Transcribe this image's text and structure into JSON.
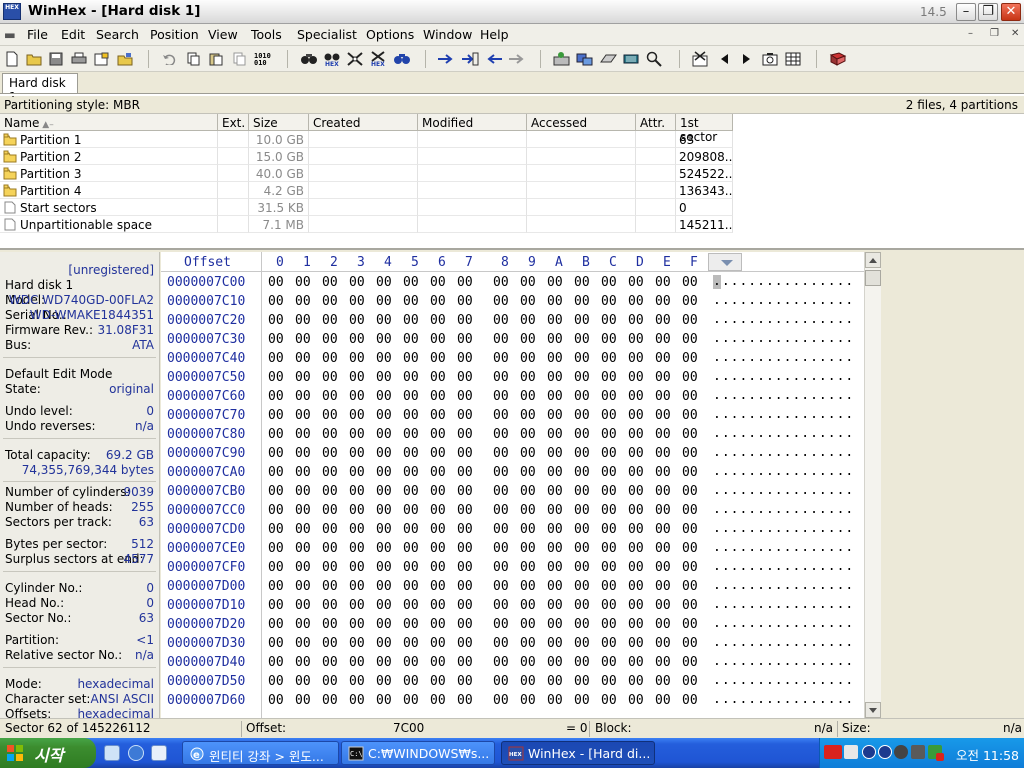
{
  "window": {
    "icon_text": "HEX",
    "title": "WinHex - [Hard disk 1]",
    "version": "14.5"
  },
  "menu": [
    "File",
    "Edit",
    "Search",
    "Position",
    "View",
    "Tools",
    "Specialist",
    "Options",
    "Window",
    "Help"
  ],
  "tabs": [
    {
      "label": "Hard disk 1"
    }
  ],
  "info": {
    "partitioning_style": "Partitioning style: MBR",
    "summary": "2 files, 4 partitions"
  },
  "partition_list": {
    "columns": [
      "Name",
      "Ext.",
      "Size",
      "Created",
      "Modified",
      "Accessed",
      "Attr.",
      "1st sector"
    ],
    "rows": [
      {
        "name": "Partition 1",
        "ext": "",
        "size": "10.0 GB",
        "created": "",
        "modified": "",
        "accessed": "",
        "attr": "",
        "first_sector": "63",
        "type": "folder"
      },
      {
        "name": "Partition 2",
        "ext": "",
        "size": "15.0 GB",
        "created": "",
        "modified": "",
        "accessed": "",
        "attr": "",
        "first_sector": "209808...",
        "type": "folder"
      },
      {
        "name": "Partition 3",
        "ext": "",
        "size": "40.0 GB",
        "created": "",
        "modified": "",
        "accessed": "",
        "attr": "",
        "first_sector": "524522...",
        "type": "folder"
      },
      {
        "name": "Partition 4",
        "ext": "",
        "size": "4.2 GB",
        "created": "",
        "modified": "",
        "accessed": "",
        "attr": "",
        "first_sector": "136343...",
        "type": "folder"
      },
      {
        "name": "Start sectors",
        "ext": "",
        "size": "31.5 KB",
        "created": "",
        "modified": "",
        "accessed": "",
        "attr": "",
        "first_sector": "0",
        "type": "file"
      },
      {
        "name": "Unpartitionable space",
        "ext": "",
        "size": "7.1 MB",
        "created": "",
        "modified": "",
        "accessed": "",
        "attr": "",
        "first_sector": "145211...",
        "type": "file"
      }
    ]
  },
  "details": {
    "unregistered": "[unregistered]",
    "disk_name": "Hard disk 1",
    "model_label": "Model:",
    "model_value": "WDC WD740GD-00FLA2",
    "serial_label": "Serial No.:",
    "serial_value": "WD-WMAKE1844351",
    "firmware_label": "Firmware Rev.:",
    "firmware_value": "31.08F31",
    "bus_label": "Bus:",
    "bus_value": "ATA",
    "edit_mode_label": "Default Edit Mode",
    "state_label": "State:",
    "state_value": "original",
    "undo_level_label": "Undo level:",
    "undo_level_value": "0",
    "undo_reverses_label": "Undo reverses:",
    "undo_reverses_value": "n/a",
    "total_capacity_label": "Total capacity:",
    "total_capacity_gb": "69.2 GB",
    "total_capacity_bytes": "74,355,769,344 bytes",
    "cylinders_label": "Number of cylinders:",
    "cylinders_value": "9039",
    "heads_label": "Number of heads:",
    "heads_value": "255",
    "sectors_track_label": "Sectors per track:",
    "sectors_track_value": "63",
    "bytes_sector_label": "Bytes per sector:",
    "bytes_sector_value": "512",
    "surplus_label": "Surplus sectors at end:",
    "surplus_value": "4577",
    "cylinder_no_label": "Cylinder No.:",
    "cylinder_no_value": "0",
    "head_no_label": "Head No.:",
    "head_no_value": "0",
    "sector_no_label": "Sector No.:",
    "sector_no_value": "63",
    "partition_label": "Partition:",
    "partition_value": "<1",
    "relative_sector_label": "Relative sector No.:",
    "relative_sector_value": "n/a",
    "mode_label": "Mode:",
    "mode_value": "hexadecimal",
    "charset_label": "Character set:",
    "charset_value": "ANSI ASCII",
    "offsets_label": "Offsets:",
    "offsets_value": "hexadecimal"
  },
  "hex": {
    "offset_header": "Offset",
    "columns": [
      "0",
      "1",
      "2",
      "3",
      "4",
      "5",
      "6",
      "7",
      "8",
      "9",
      "A",
      "B",
      "C",
      "D",
      "E",
      "F"
    ],
    "rows": [
      "0000007C00",
      "0000007C10",
      "0000007C20",
      "0000007C30",
      "0000007C40",
      "0000007C50",
      "0000007C60",
      "0000007C70",
      "0000007C80",
      "0000007C90",
      "0000007CA0",
      "0000007CB0",
      "0000007CC0",
      "0000007CD0",
      "0000007CE0",
      "0000007CF0",
      "0000007D00",
      "0000007D10",
      "0000007D20",
      "0000007D30",
      "0000007D40",
      "0000007D50",
      "0000007D60"
    ],
    "byte_value": "00",
    "ascii_row": "................"
  },
  "status": {
    "sector": "Sector 62 of 145226112",
    "offset_label": "Offset:",
    "offset_value": "7C00",
    "equals_value": "= 0",
    "block_label": "Block:",
    "block_value": "n/a",
    "size_label": "Size:",
    "size_value": "n/a"
  },
  "taskbar": {
    "start_label": "시작",
    "buttons": [
      {
        "label": "윈티티 강좌 > 윈도...",
        "active": false
      },
      {
        "label": "C:₩WINDOWS₩s...",
        "active": false
      },
      {
        "label": "WinHex - [Hard di...",
        "active": true
      }
    ],
    "clock": "오전 11:58"
  },
  "colors": {
    "offset_blue": "#1f2fa0",
    "value_blue": "#22339a",
    "taskbar_blue": "#245edc",
    "start_green": "#3c8d2f",
    "close_red": "#c63516"
  }
}
